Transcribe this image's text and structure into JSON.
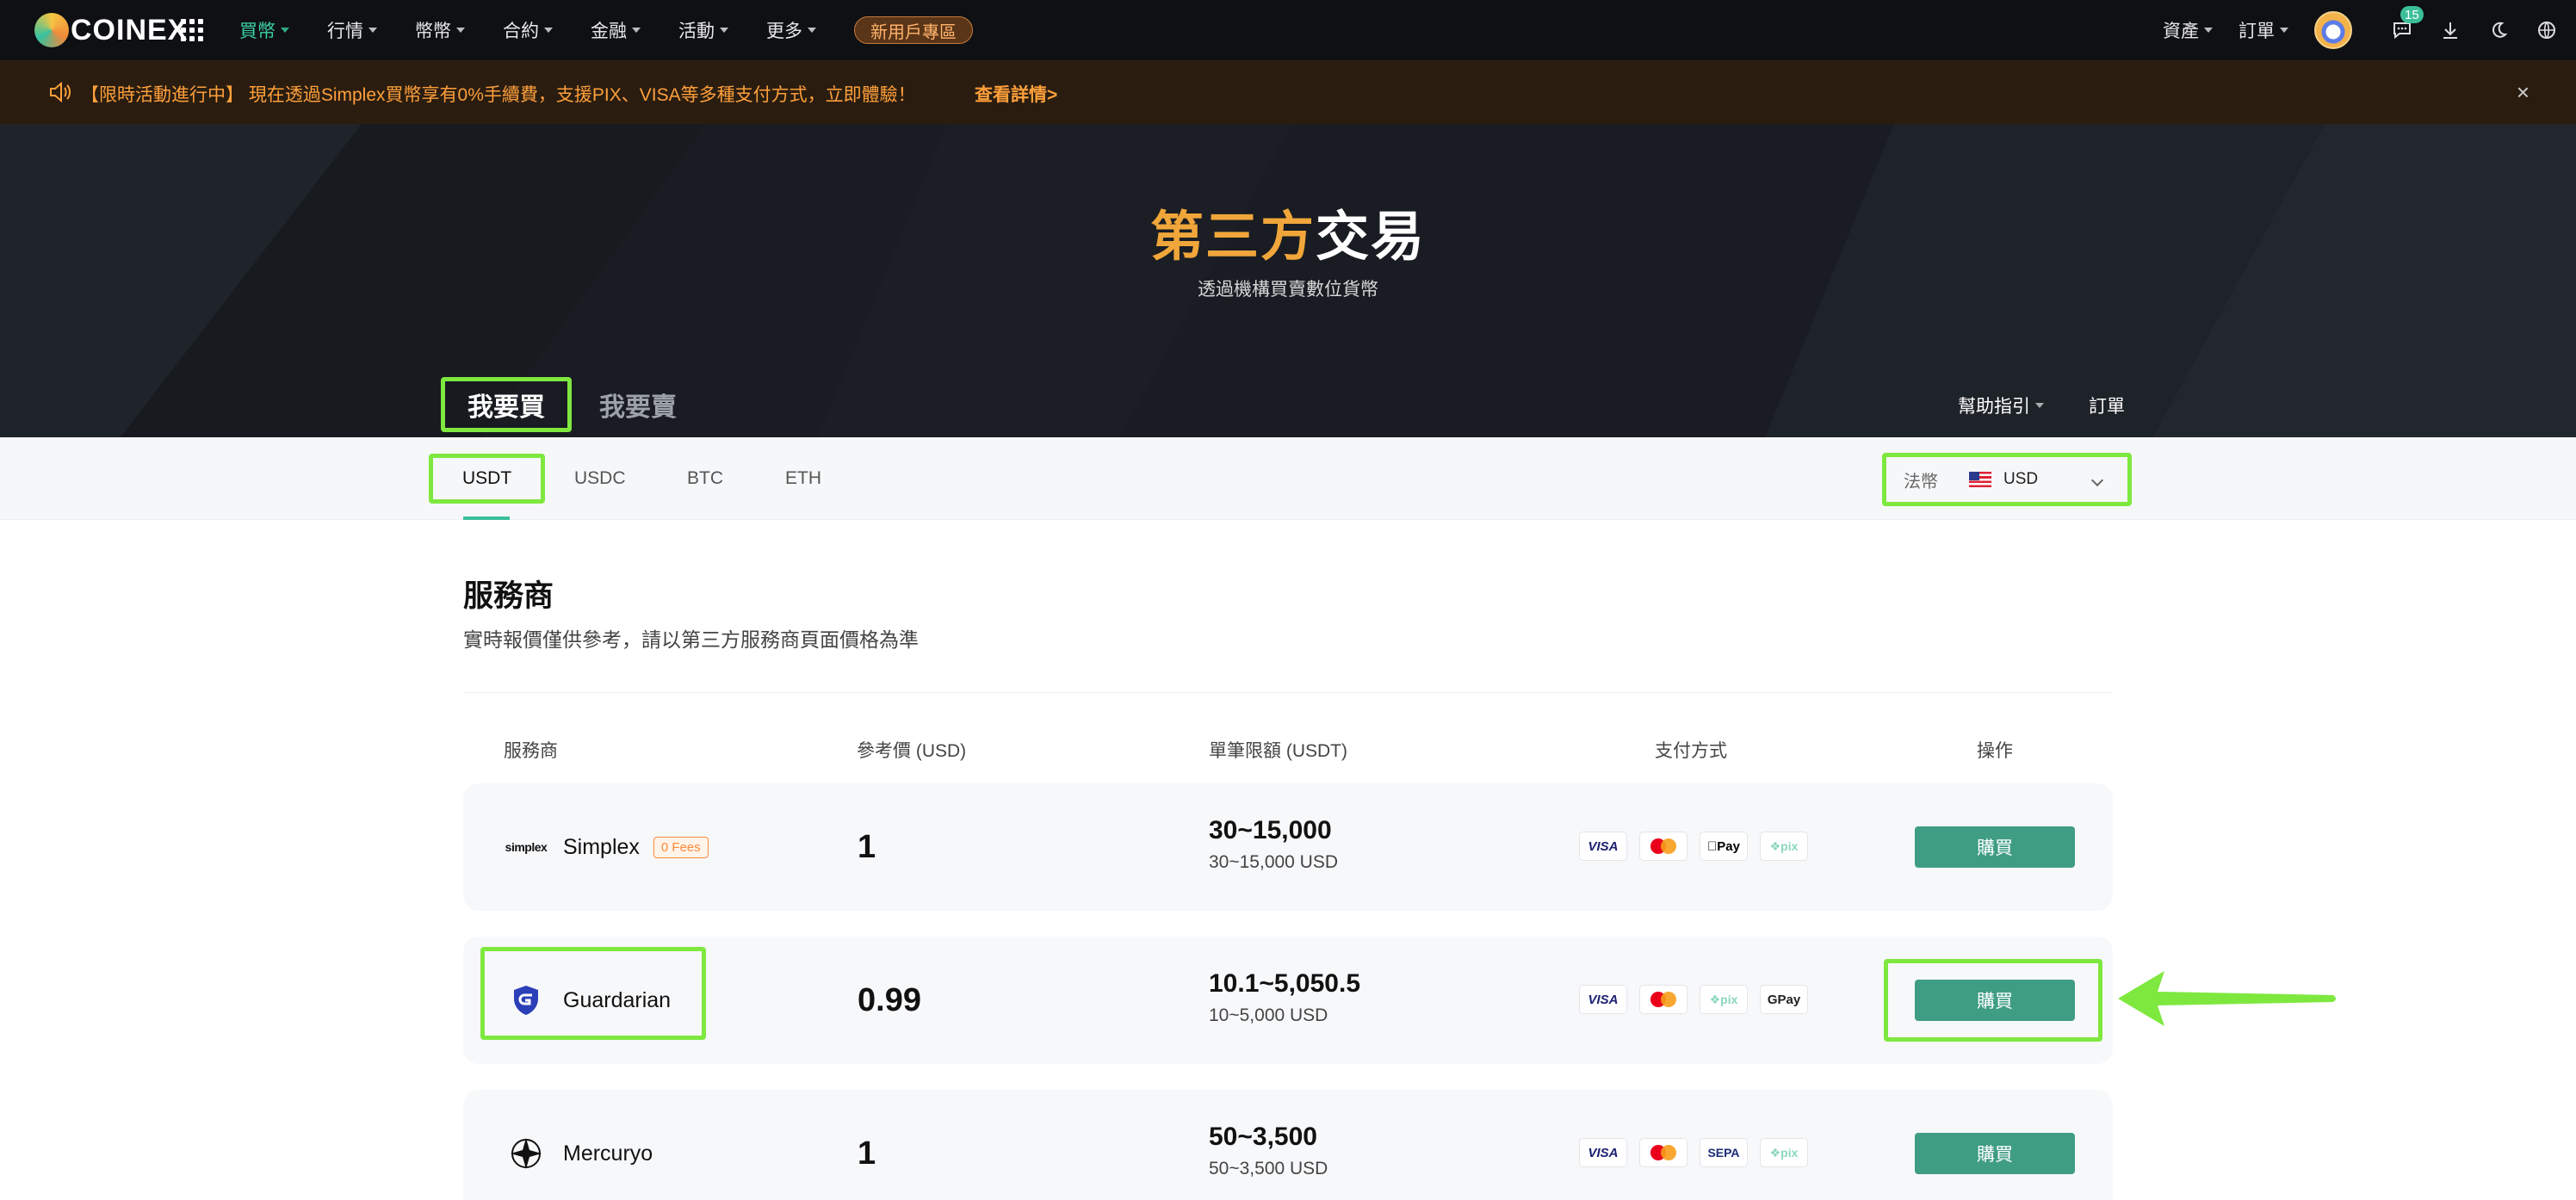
{
  "header": {
    "logo_text": "COINEX",
    "nav": [
      {
        "label": "買幣",
        "active": true
      },
      {
        "label": "行情"
      },
      {
        "label": "幣幣"
      },
      {
        "label": "合約"
      },
      {
        "label": "金融"
      },
      {
        "label": "活動"
      },
      {
        "label": "更多"
      }
    ],
    "new_user_label": "新用戶專區",
    "assets_label": "資產",
    "orders_label": "訂單",
    "message_count": "15"
  },
  "announcement": {
    "message": "【限時活動進行中】 現在透過Simplex買幣享有0%手續費，支援PIX、VISA等多種支付方式，立即體驗！",
    "details_link": "查看詳情>",
    "close": "×"
  },
  "hero": {
    "title_highlight": "第三方",
    "title_rest": "交易",
    "subtitle": "透過機構買賣數位貨幣",
    "buy_tab": "我要買",
    "sell_tab": "我要賣",
    "help_label": "幫助指引",
    "orders_label": "訂單"
  },
  "currency_tabs": [
    "USDT",
    "USDC",
    "BTC",
    "ETH"
  ],
  "fiat": {
    "label": "法幣",
    "code": "USD"
  },
  "section": {
    "title": "服務商",
    "subtitle": "實時報價僅供參考，請以第三方服務商頁面價格為準"
  },
  "table": {
    "headers": {
      "provider": "服務商",
      "price": "參考價 (USD)",
      "limit": "單筆限額 (USDT)",
      "payment": "支付方式",
      "action": "操作"
    },
    "rows": [
      {
        "provider": "Simplex",
        "logo_text": "simplex",
        "badge": "0 Fees",
        "price": "1",
        "limit": "30~15,000",
        "limit_fiat": "30~15,000 USD",
        "payments": [
          "VISA",
          "mastercard",
          "Pay",
          "pix"
        ],
        "button": "購買"
      },
      {
        "provider": "Guardarian",
        "price": "0.99",
        "limit": "10.1~5,050.5",
        "limit_fiat": "10~5,000 USD",
        "payments": [
          "VISA",
          "mastercard",
          "pix",
          "Pay"
        ],
        "button": "購買"
      },
      {
        "provider": "Mercuryo",
        "price": "1",
        "limit": "50~3,500",
        "limit_fiat": "50~3,500 USD",
        "payments": [
          "VISA",
          "mastercard",
          "SEPA",
          "pix"
        ],
        "button": "購買"
      }
    ]
  },
  "colors": {
    "accent": "#3bd0a4",
    "buy_button": "#3f9d84",
    "highlight_box": "#7ee83f",
    "announce_text": "#ff9f3a",
    "hero_highlight": "#f0a63a"
  }
}
